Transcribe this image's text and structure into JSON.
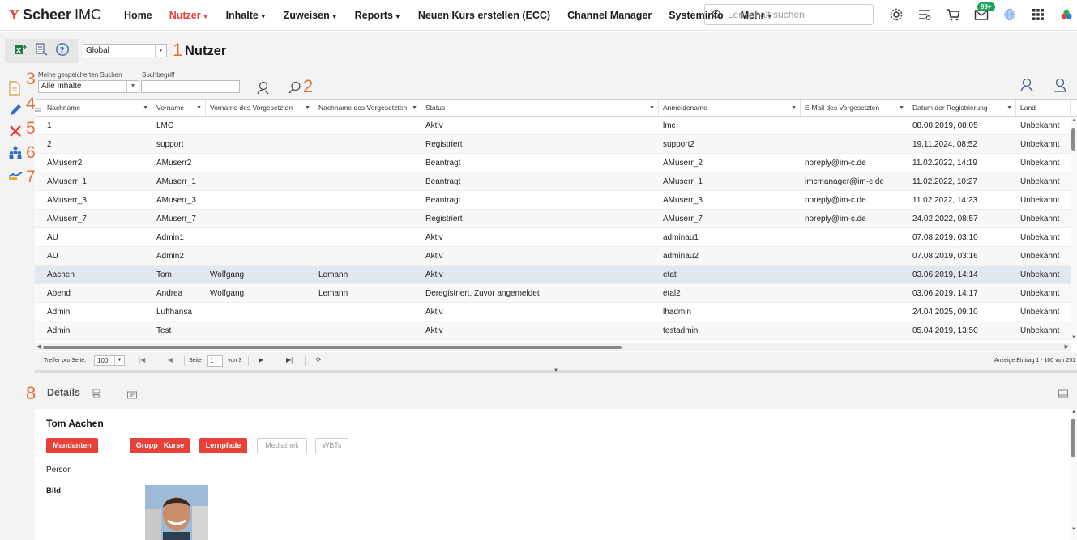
{
  "app": {
    "logo_mark": "Y",
    "brand_bold": "Scheer",
    "brand_light": "IMC"
  },
  "nav": {
    "items": [
      {
        "label": "Home",
        "active": false,
        "caret": false
      },
      {
        "label": "Nutzer",
        "active": true,
        "caret": true
      },
      {
        "label": "Inhalte",
        "active": false,
        "caret": true
      },
      {
        "label": "Zuweisen",
        "active": false,
        "caret": true
      },
      {
        "label": "Reports",
        "active": false,
        "caret": true
      },
      {
        "label": "Neuen Kurs erstellen (ECC)",
        "active": false,
        "caret": false
      },
      {
        "label": "Channel Manager",
        "active": false,
        "caret": false
      },
      {
        "label": "Systeminfo",
        "active": false,
        "caret": false
      },
      {
        "label": "Mehr",
        "active": false,
        "caret": true
      }
    ],
    "search_placeholder": "Lerninhalt suchen",
    "mail_badge": "99+"
  },
  "titlebar": {
    "scope_value": "Global",
    "marker_1": "1",
    "title": "Nutzer"
  },
  "filters": {
    "saved_search_label": "Meine gespeicherten Suchen",
    "saved_search_value": "Alle Inhalte",
    "search_term_label": "Suchbegriff",
    "marker_2": "2",
    "marker_3": "3"
  },
  "rail_markers": [
    "4",
    "5",
    "6",
    "7"
  ],
  "grid": {
    "columns": [
      "Nachname",
      "Vorname",
      "Vorname des Vorgesetzten",
      "Nachname des Vorgesetzten",
      "Status",
      "Anmeldename",
      "E-Mail des Vorgesetzten",
      "Datum der Registrierung",
      "Land"
    ],
    "rows": [
      [
        "1",
        "LMC",
        "",
        "",
        "Aktiv",
        "lmc",
        "",
        "08.08.2019, 08:05",
        "Unbekannt"
      ],
      [
        "2",
        "support",
        "",
        "",
        "Registriert",
        "support2",
        "",
        "19.11.2024, 08:52",
        "Unbekannt"
      ],
      [
        "AMuserr2",
        "AMuserr2",
        "",
        "",
        "Beantragt",
        "AMuserr_2",
        "noreply@im-c.de",
        "11.02.2022, 14:19",
        "Unbekannt"
      ],
      [
        "AMuserr_1",
        "AMuserr_1",
        "",
        "",
        "Beantragt",
        "AMuserr_1",
        "imcmanager@im-c.de",
        "11.02.2022, 10:27",
        "Unbekannt"
      ],
      [
        "AMuserr_3",
        "AMuserr_3",
        "",
        "",
        "Beantragt",
        "AMuserr_3",
        "noreply@im-c.de",
        "11.02.2022, 14:23",
        "Unbekannt"
      ],
      [
        "AMuserr_7",
        "AMuserr_7",
        "",
        "",
        "Registriert",
        "AMuserr_7",
        "noreply@im-c.de",
        "24.02.2022, 08:57",
        "Unbekannt"
      ],
      [
        "AU",
        "Admin1",
        "",
        "",
        "Aktiv",
        "adminau1",
        "",
        "07.08.2019, 03:10",
        "Unbekannt"
      ],
      [
        "AU",
        "Admin2",
        "",
        "",
        "Aktiv",
        "adminau2",
        "",
        "07.08.2019, 03:16",
        "Unbekannt"
      ],
      [
        "Aachen",
        "Tom",
        "Wolfgang",
        "Lemann",
        "Aktiv",
        "etat",
        "",
        "03.06.2019, 14:14",
        "Unbekannt"
      ],
      [
        "Abend",
        "Andrea",
        "Wolfgang",
        "Lemann",
        "Deregistriert, Zuvor angemeldet",
        "etal2",
        "",
        "03.06.2019, 14:17",
        "Unbekannt"
      ],
      [
        "Admin",
        "Lufthansa",
        "",
        "",
        "Aktiv",
        "lhadmin",
        "",
        "24.04.2025, 09:10",
        "Unbekannt"
      ],
      [
        "Admin",
        "Test",
        "",
        "",
        "Aktiv",
        "testadmin",
        "",
        "05.04.2019, 13:50",
        "Unbekannt"
      ]
    ],
    "selected_row": 8
  },
  "pager": {
    "per_page_label": "Treffer pro Seite:",
    "per_page_value": "100",
    "page_label": "Seite",
    "page_value": "1",
    "of_label": "von 3",
    "info": "Anzeige Eintrag 1 - 100 von 251"
  },
  "details": {
    "marker_8": "8",
    "title": "Details",
    "person_name": "Tom Aachen",
    "buttons": [
      {
        "label": "Mandanten",
        "enabled": true
      },
      {
        "label": "Gruppen",
        "enabled": true
      },
      {
        "label": "Kurse",
        "enabled": true
      },
      {
        "label": "Lernpfade",
        "enabled": true
      },
      {
        "label": "Mediathek",
        "enabled": false
      },
      {
        "label": "WBTs",
        "enabled": false
      }
    ],
    "person_type": "Person",
    "image_label": "Bild"
  },
  "colors": {
    "accent": "#e8413a",
    "marker": "#e8713a",
    "badge": "#19a35b",
    "selected_row": "#e2e8ef"
  }
}
